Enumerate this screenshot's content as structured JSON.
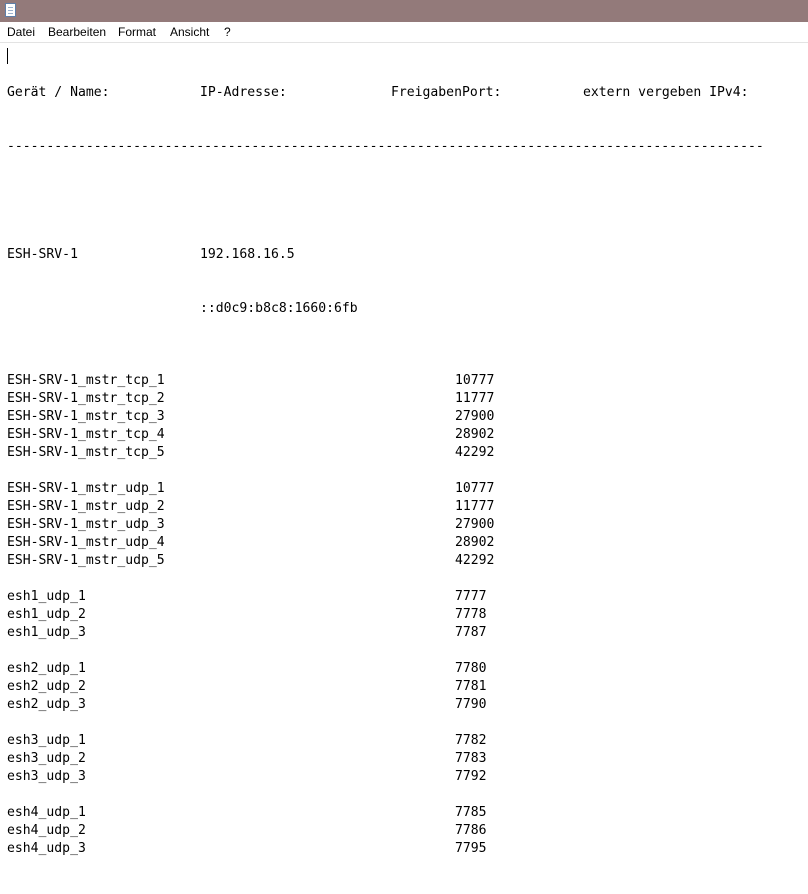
{
  "menu": {
    "items": [
      "Datei",
      "Bearbeiten",
      "Format",
      "Ansicht",
      "?"
    ]
  },
  "document": {
    "header": {
      "col1": "Gerät / Name:",
      "col2": "IP-Adresse:",
      "col3": "FreigabenPort:",
      "col4": "extern vergeben IPv4:"
    },
    "separator": "------------------------------------------------------------------------------------------------",
    "server": {
      "name": "ESH-SRV-1",
      "ipv4": "192.168.16.5",
      "ipv6": "::d0c9:b8c8:1660:6fb"
    },
    "port_groups": [
      [
        {
          "name": "ESH-SRV-1_mstr_tcp_1",
          "port": "10777"
        },
        {
          "name": "ESH-SRV-1_mstr_tcp_2",
          "port": "11777"
        },
        {
          "name": "ESH-SRV-1_mstr_tcp_3",
          "port": "27900"
        },
        {
          "name": "ESH-SRV-1_mstr_tcp_4",
          "port": "28902"
        },
        {
          "name": "ESH-SRV-1_mstr_tcp_5",
          "port": "42292"
        }
      ],
      [
        {
          "name": "ESH-SRV-1_mstr_udp_1",
          "port": "10777"
        },
        {
          "name": "ESH-SRV-1_mstr_udp_2",
          "port": "11777"
        },
        {
          "name": "ESH-SRV-1_mstr_udp_3",
          "port": "27900"
        },
        {
          "name": "ESH-SRV-1_mstr_udp_4",
          "port": "28902"
        },
        {
          "name": "ESH-SRV-1_mstr_udp_5",
          "port": "42292"
        }
      ],
      [
        {
          "name": "esh1_udp_1",
          "port": "7777"
        },
        {
          "name": "esh1_udp_2",
          "port": "7778"
        },
        {
          "name": "esh1_udp_3",
          "port": "7787"
        }
      ],
      [
        {
          "name": "esh2_udp_1",
          "port": "7780"
        },
        {
          "name": "esh2_udp_2",
          "port": "7781"
        },
        {
          "name": "esh2_udp_3",
          "port": "7790"
        }
      ],
      [
        {
          "name": "esh3_udp_1",
          "port": "7782"
        },
        {
          "name": "esh3_udp_2",
          "port": "7783"
        },
        {
          "name": "esh3_udp_3",
          "port": "7792"
        }
      ],
      [
        {
          "name": "esh4_udp_1",
          "port": "7785"
        },
        {
          "name": "esh4_udp_2",
          "port": "7786"
        },
        {
          "name": "esh4_udp_3",
          "port": "7795"
        }
      ]
    ]
  }
}
